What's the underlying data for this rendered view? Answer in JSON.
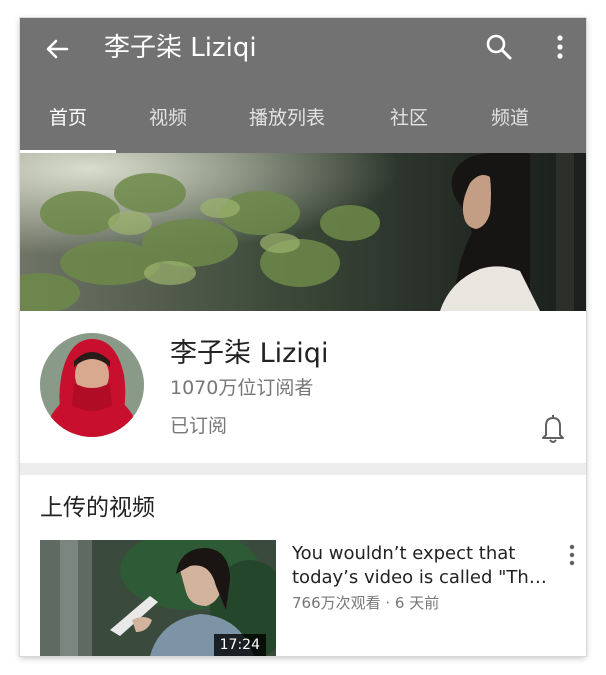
{
  "header": {
    "title": "李子柒 Liziqi",
    "icons": {
      "back": "arrow-back-icon",
      "search": "search-icon",
      "more": "more-vert-icon"
    }
  },
  "tabs": [
    {
      "label": "首页",
      "active": true
    },
    {
      "label": "视频",
      "active": false
    },
    {
      "label": "播放列表",
      "active": false
    },
    {
      "label": "社区",
      "active": false
    },
    {
      "label": "频道",
      "active": false
    }
  ],
  "channel": {
    "name": "李子柒 Liziqi",
    "subscribers": "1070万位订阅者",
    "subscribed_label": "已订阅",
    "bell_icon": "bell-icon"
  },
  "uploads": {
    "section_title": "上传的视频",
    "videos": [
      {
        "title_line1": "You wouldn’t expect that",
        "title_line2": "today’s video is called \"Th…",
        "meta": "766万次观看 · 6 天前",
        "duration": "17:24"
      }
    ]
  },
  "colors": {
    "appbar": "#727272",
    "divider": "#ededed",
    "text_primary": "#222222",
    "text_secondary": "#777777",
    "avatar_red": "#c8102e"
  }
}
